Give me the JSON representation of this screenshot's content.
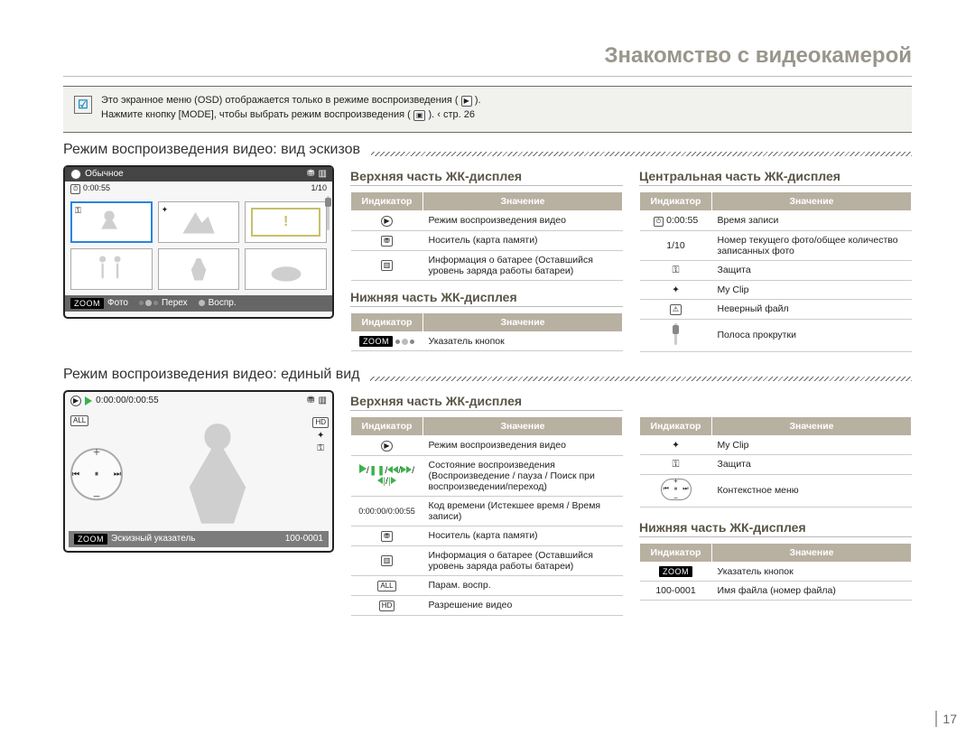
{
  "header_title": "Знакомство с видеокамерой",
  "note": {
    "line1": "Это экранное меню (OSD) отображается только в режиме воспроизведения (",
    "line1b": ").",
    "line2a": "Нажмите кнопку [MODE], чтобы выбрать режим воспроизведения (",
    "line2b": "). ",
    "line2c": "‹ стр. 26"
  },
  "section1_title": "Режим воспроизведения видео: вид эскизов",
  "section2_title": "Режим воспроизведения видео: единый вид",
  "screen1": {
    "mode_label": "Обычное",
    "time": "0:00:55",
    "counter": "1/10",
    "foot_photo": "Фото",
    "foot_move": "Перех",
    "foot_play": "Воспр."
  },
  "screen2": {
    "time": "0:00:00/0:00:55",
    "hd": "HD",
    "foot_label": "Эскизный указатель",
    "file": "100-0001"
  },
  "th": {
    "ind": "Индикатор",
    "val": "Значение"
  },
  "upper1": {
    "title": "Верхняя часть ЖК-дисплея",
    "r1": "Режим воспроизведения видео",
    "r2": "Носитель (карта памяти)",
    "r3": "Информация о батарее (Оставшийся уровень заряда работы батареи)"
  },
  "lower1": {
    "title": "Нижняя часть ЖК-дисплея",
    "r1": "Указатель кнопок"
  },
  "center1": {
    "title": "Центральная часть ЖК-дисплея",
    "r1": {
      "ind": "0:00:55",
      "val": "Время записи"
    },
    "r2": {
      "ind": "1/10",
      "val": "Номер текущего фото/общее количество записанных фото"
    },
    "r3": "Защита",
    "r4": "My Clip",
    "r5": "Неверный файл",
    "r6": "Полоса прокрутки"
  },
  "upper2": {
    "title": "Верхняя часть ЖК-дисплея",
    "left": {
      "r1": "Режим воспроизведения видео",
      "r2": "Состояние воспроизведения (Воспроизведение / пауза / Поиск при воспроизведении/переход)",
      "r3": {
        "ind": "0:00:00/0:00:55",
        "val": "Код времени (Истекшее время / Время записи)"
      },
      "r4": "Носитель (карта памяти)",
      "r5": "Информация о батарее (Оставшийся уровень заряда работы батареи)",
      "r6": "Парам. воспр.",
      "r7": "Разрешение видео"
    },
    "right": {
      "r1": "My Clip",
      "r2": "Защита",
      "r3": "Контекстное меню"
    }
  },
  "lower2": {
    "title": "Нижняя часть ЖК-дисплея",
    "r1": "Указатель кнопок",
    "r2": {
      "ind": "100-0001",
      "val": "Имя файла (номер файла)"
    }
  },
  "page_number": "17"
}
